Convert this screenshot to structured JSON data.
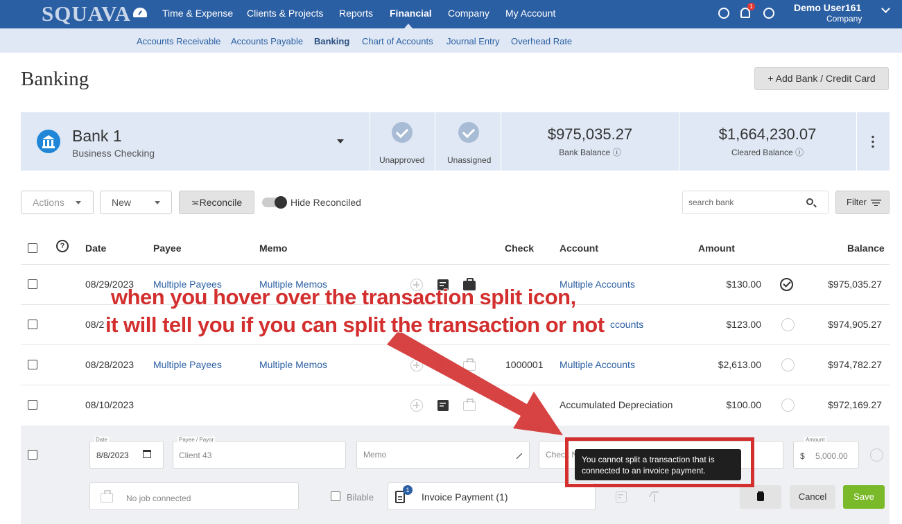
{
  "app": {
    "logo": "SQUAVA"
  },
  "topnav": {
    "items": [
      "Time & Expense",
      "Clients & Projects",
      "Reports",
      "Financial",
      "Company",
      "My Account"
    ],
    "active": "Financial",
    "notification_count": "1",
    "user_name": "Demo User161",
    "user_company": "Company"
  },
  "subnav": {
    "items": [
      "Accounts Receivable",
      "Accounts Payable",
      "Banking",
      "Chart of Accounts",
      "Journal Entry",
      "Overhead Rate"
    ],
    "active": "Banking"
  },
  "page": {
    "title": "Banking",
    "add_button": "+ Add Bank / Credit Card"
  },
  "bank": {
    "name": "Bank 1",
    "type": "Business Checking",
    "unapproved_label": "Unapproved",
    "unassigned_label": "Unassigned",
    "bank_balance": "$975,035.27",
    "bank_balance_label": "Bank Balance",
    "cleared_balance": "$1,664,230.07",
    "cleared_balance_label": "Cleared Balance"
  },
  "toolbar": {
    "actions": "Actions",
    "new": "New",
    "reconcile": "Reconcile",
    "hide_reconciled": "Hide Reconciled",
    "search_placeholder": "search bank",
    "filter": "Filter"
  },
  "table": {
    "headers": {
      "help": "?",
      "date": "Date",
      "payee": "Payee",
      "memo": "Memo",
      "check": "Check",
      "account": "Account",
      "amount": "Amount",
      "balance": "Balance"
    },
    "rows": [
      {
        "date": "08/29/2023",
        "payee": "Multiple Payees",
        "memo": "Multiple Memos",
        "check": "",
        "account": "Multiple Accounts",
        "amount": "$130.00",
        "balance": "$975,035.27"
      },
      {
        "date": "08/2",
        "payee": "",
        "memo": "",
        "check": "",
        "account": "ccounts",
        "amount": "$123.00",
        "balance": "$974,905.27"
      },
      {
        "date": "08/28/2023",
        "payee": "Multiple Payees",
        "memo": "Multiple Memos",
        "check": "1000001",
        "account": "Multiple Accounts",
        "amount": "$2,613.00",
        "balance": "$974,782.27"
      },
      {
        "date": "08/10/2023",
        "payee": "",
        "memo": "",
        "check": "",
        "account": "Accumulated Depreciation",
        "amount": "$100.00",
        "balance": "$972,169.27"
      }
    ]
  },
  "edit_row": {
    "date_label": "Date",
    "date": "8/8/2023",
    "payee_label": "Payee / Payor",
    "payee_placeholder": "Client 43",
    "memo_placeholder": "Memo",
    "check_placeholder": "Check N",
    "amount_label": "Amount",
    "amount_currency": "$",
    "amount_value": "5,000.00",
    "job_placeholder": "No job connected",
    "billable_label": "Bilable",
    "invoice_count": "1",
    "invoice_payment": "Invoice Payment (1)",
    "cancel": "Cancel",
    "save": "Save"
  },
  "tooltip": {
    "text": "You cannot split a transaction that is connected to an invoice payment."
  },
  "annotation": {
    "line1": "when you hover over the transaction split icon,",
    "line2": "it will tell you if you can split the transaction or not"
  },
  "colors": {
    "topbar": "#2b5fa3",
    "subnav": "#dfe8f4",
    "link": "#2b5fa3",
    "save": "#7ab929",
    "annotation": "#d32f2f"
  }
}
